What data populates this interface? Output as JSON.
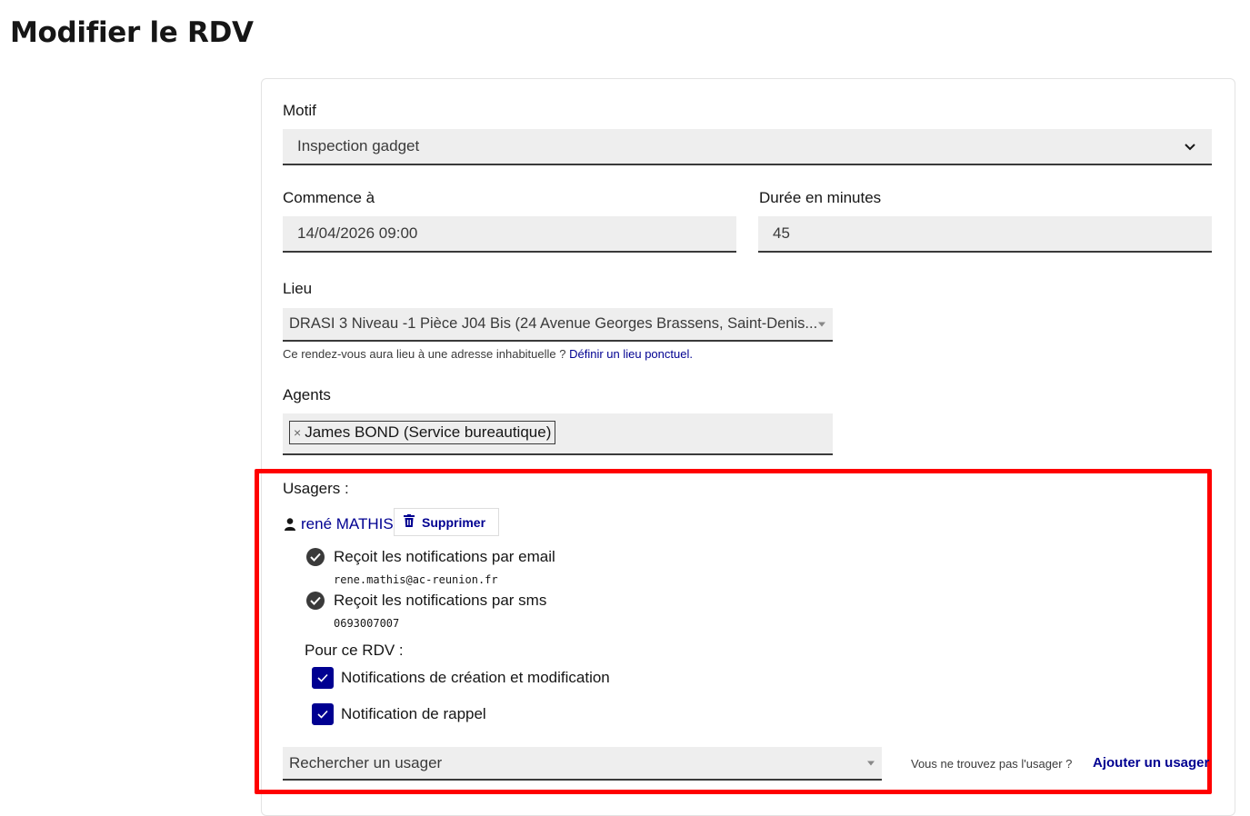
{
  "page": {
    "title": "Modifier le RDV"
  },
  "motif": {
    "label": "Motif",
    "value": "Inspection gadget"
  },
  "start": {
    "label": "Commence à",
    "value": "14/04/2026 09:00"
  },
  "duration": {
    "label": "Durée en minutes",
    "value": "45"
  },
  "lieu": {
    "label": "Lieu",
    "value": "DRASI 3  Niveau -1  Pièce J04 Bis (24 Avenue Georges Brassens, Saint-Denis...",
    "help_text": "Ce rendez-vous aura lieu à une adresse inhabituelle ?",
    "help_link": "Définir un lieu ponctuel."
  },
  "agents": {
    "label": "Agents",
    "selected": [
      "James BOND (Service bureautique)"
    ],
    "remove_symbol": "×"
  },
  "usagers": {
    "label": "Usagers :",
    "user": {
      "name": "rené MATHIS",
      "delete_label": "Supprimer",
      "email_notif": "Reçoit les notifications par email",
      "email": "rene.mathis@ac-reunion.fr",
      "sms_notif": "Reçoit les notifications par sms",
      "phone": "0693007007"
    },
    "for_rdv_label": "Pour ce RDV :",
    "options": [
      {
        "label": "Notifications de création et modification",
        "checked": true
      },
      {
        "label": "Notification de rappel",
        "checked": true
      }
    ],
    "search_placeholder": "Rechercher un usager",
    "not_found_text": "Vous ne trouvez pas l'usager ?",
    "add_link": "Ajouter un usager"
  },
  "colors": {
    "accent": "#000091",
    "highlight_border": "#ff0000",
    "field_bg": "#eeeeee"
  }
}
